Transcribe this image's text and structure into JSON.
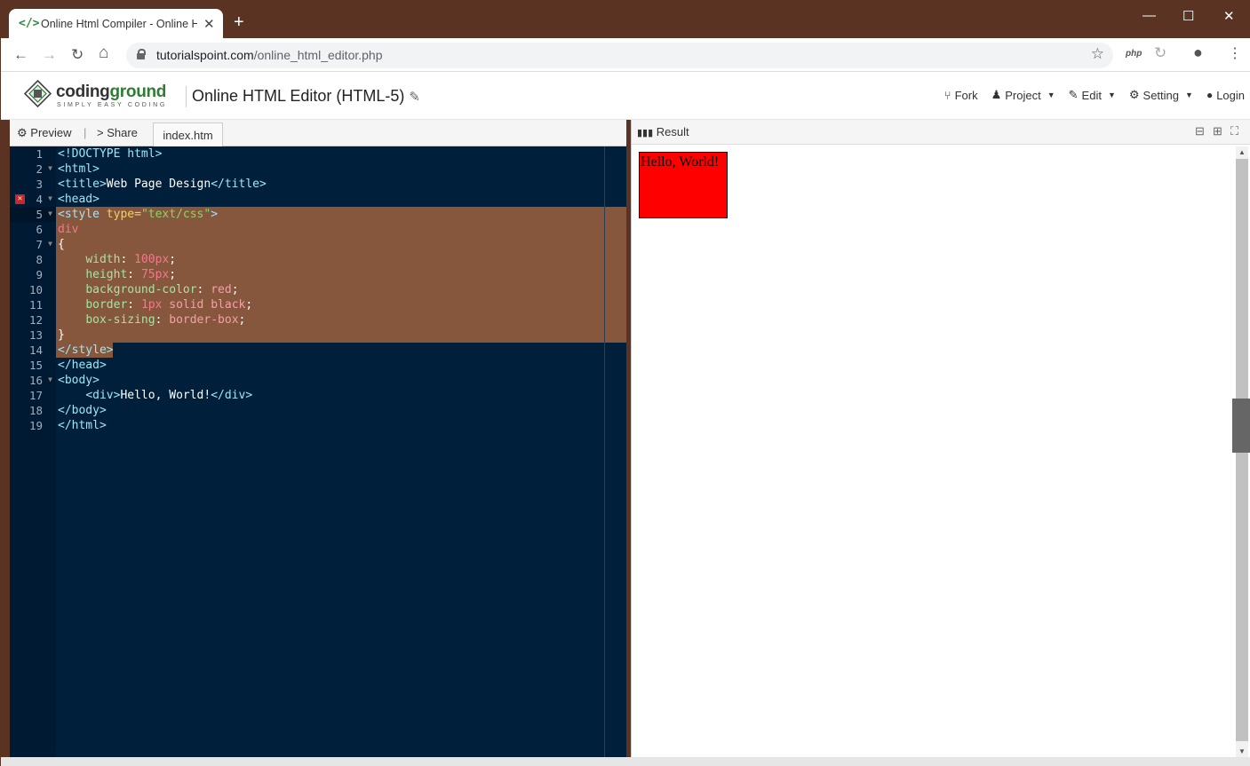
{
  "browser": {
    "tab_title": "Online Html Compiler - Online H",
    "new_tab": "+",
    "close_tab": "✕",
    "minimize": "—",
    "maximize": "☐",
    "close": "✕",
    "back": "←",
    "forward": "→",
    "reload": "↻",
    "home": "⌂",
    "url_host": "tutorialspoint.com",
    "url_path": "/online_html_editor.php",
    "bookmark": "☆",
    "ext_php": "php",
    "ext_reload": "↻",
    "profile": "●",
    "menu": "⋮"
  },
  "app": {
    "logo_word_1": "coding",
    "logo_word_2": "ground",
    "logo_tagline": "SIMPLY EASY CODING",
    "title": "Online HTML Editor (HTML-5)",
    "menu": [
      {
        "icon": "fork-icon",
        "glyph": "⑂",
        "label": "Fork"
      },
      {
        "icon": "project-icon",
        "glyph": "♟",
        "label": "Project"
      },
      {
        "icon": "edit-icon",
        "glyph": "✎",
        "label": "Edit"
      },
      {
        "icon": "gear-icon",
        "glyph": "⚙",
        "label": "Setting"
      },
      {
        "icon": "user-icon",
        "glyph": "👤",
        "label": "Login"
      }
    ]
  },
  "editor_bar": {
    "preview": "Preview",
    "separator": "|",
    "share": "Share",
    "file_tab": "index.htm"
  },
  "code_lines": [
    "1",
    "2",
    "3",
    "4",
    "5",
    "6",
    "7",
    "8",
    "9",
    "10",
    "11",
    "12",
    "13",
    "14",
    "15",
    "16",
    "17",
    "18",
    "19"
  ],
  "error_line": "4",
  "result_bar": {
    "label": "Result"
  },
  "result_text": "Hello, World!",
  "colors": {
    "selection": "#86573d",
    "editor_bg": "#001f3b",
    "chrome": "#5a3323"
  }
}
